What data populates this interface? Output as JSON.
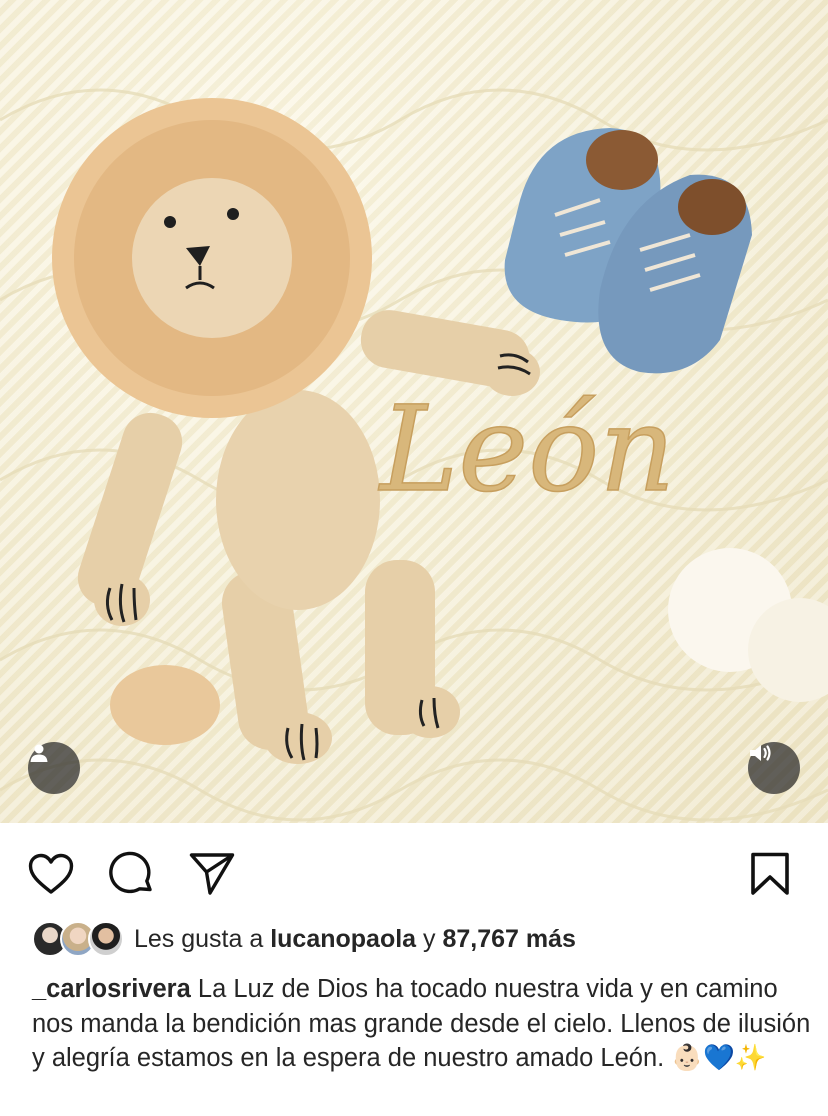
{
  "post": {
    "media": {
      "description_icon": "photo",
      "embroidered_text": "León"
    },
    "tag_button_icon": "person-icon",
    "sound_button_icon": "volume-icon",
    "actions": {
      "like_icon": "heart-icon",
      "comment_icon": "comment-icon",
      "share_icon": "paper-plane-icon",
      "save_icon": "bookmark-icon"
    },
    "likes": {
      "prefix": "Les gusta a",
      "user": "lucanopaola",
      "joiner": "y",
      "count": "87,767 más"
    },
    "caption": {
      "username": "_carlosrivera",
      "text": " La Luz de Dios ha tocado nuestra vida y en camino nos manda la bendición mas grande desde el cielo. Llenos de ilusión y alegría estamos en la espera de nuestro amado León. 👶🏻💙✨"
    }
  }
}
